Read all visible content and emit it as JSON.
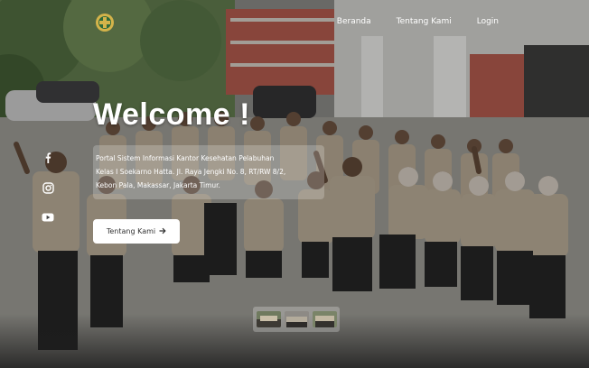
{
  "navbar": {
    "logo_icon": "ministry-emblem-icon",
    "links": [
      {
        "label": "Beranda"
      },
      {
        "label": "Tentang Kami"
      },
      {
        "label": "Login"
      }
    ]
  },
  "social": {
    "items": [
      {
        "icon": "facebook-icon"
      },
      {
        "icon": "instagram-icon"
      },
      {
        "icon": "youtube-icon"
      }
    ]
  },
  "hero": {
    "title": "Welcome !",
    "description_lines": [
      "Portal Sistem Informasi Kantor Kesehatan Pelabuhan",
      "Kelas I Soekarno Hatta. Jl. Raya Jengki No. 8, RT/RW 8/2,",
      "Kebon Pala, Makassar, Jakarta Timur."
    ],
    "cta_label": "Tentang Kami",
    "cta_icon": "arrow-right-icon"
  },
  "slider": {
    "thumbnails": [
      {
        "icon": "slide-thumbnail-1"
      },
      {
        "icon": "slide-thumbnail-2"
      },
      {
        "icon": "slide-thumbnail-3"
      }
    ]
  },
  "colors": {
    "text": "#ffffff",
    "button_bg": "#ffffff",
    "button_text": "#333333",
    "uniform": "#b9aa93",
    "trousers": "#1f1f1f"
  }
}
